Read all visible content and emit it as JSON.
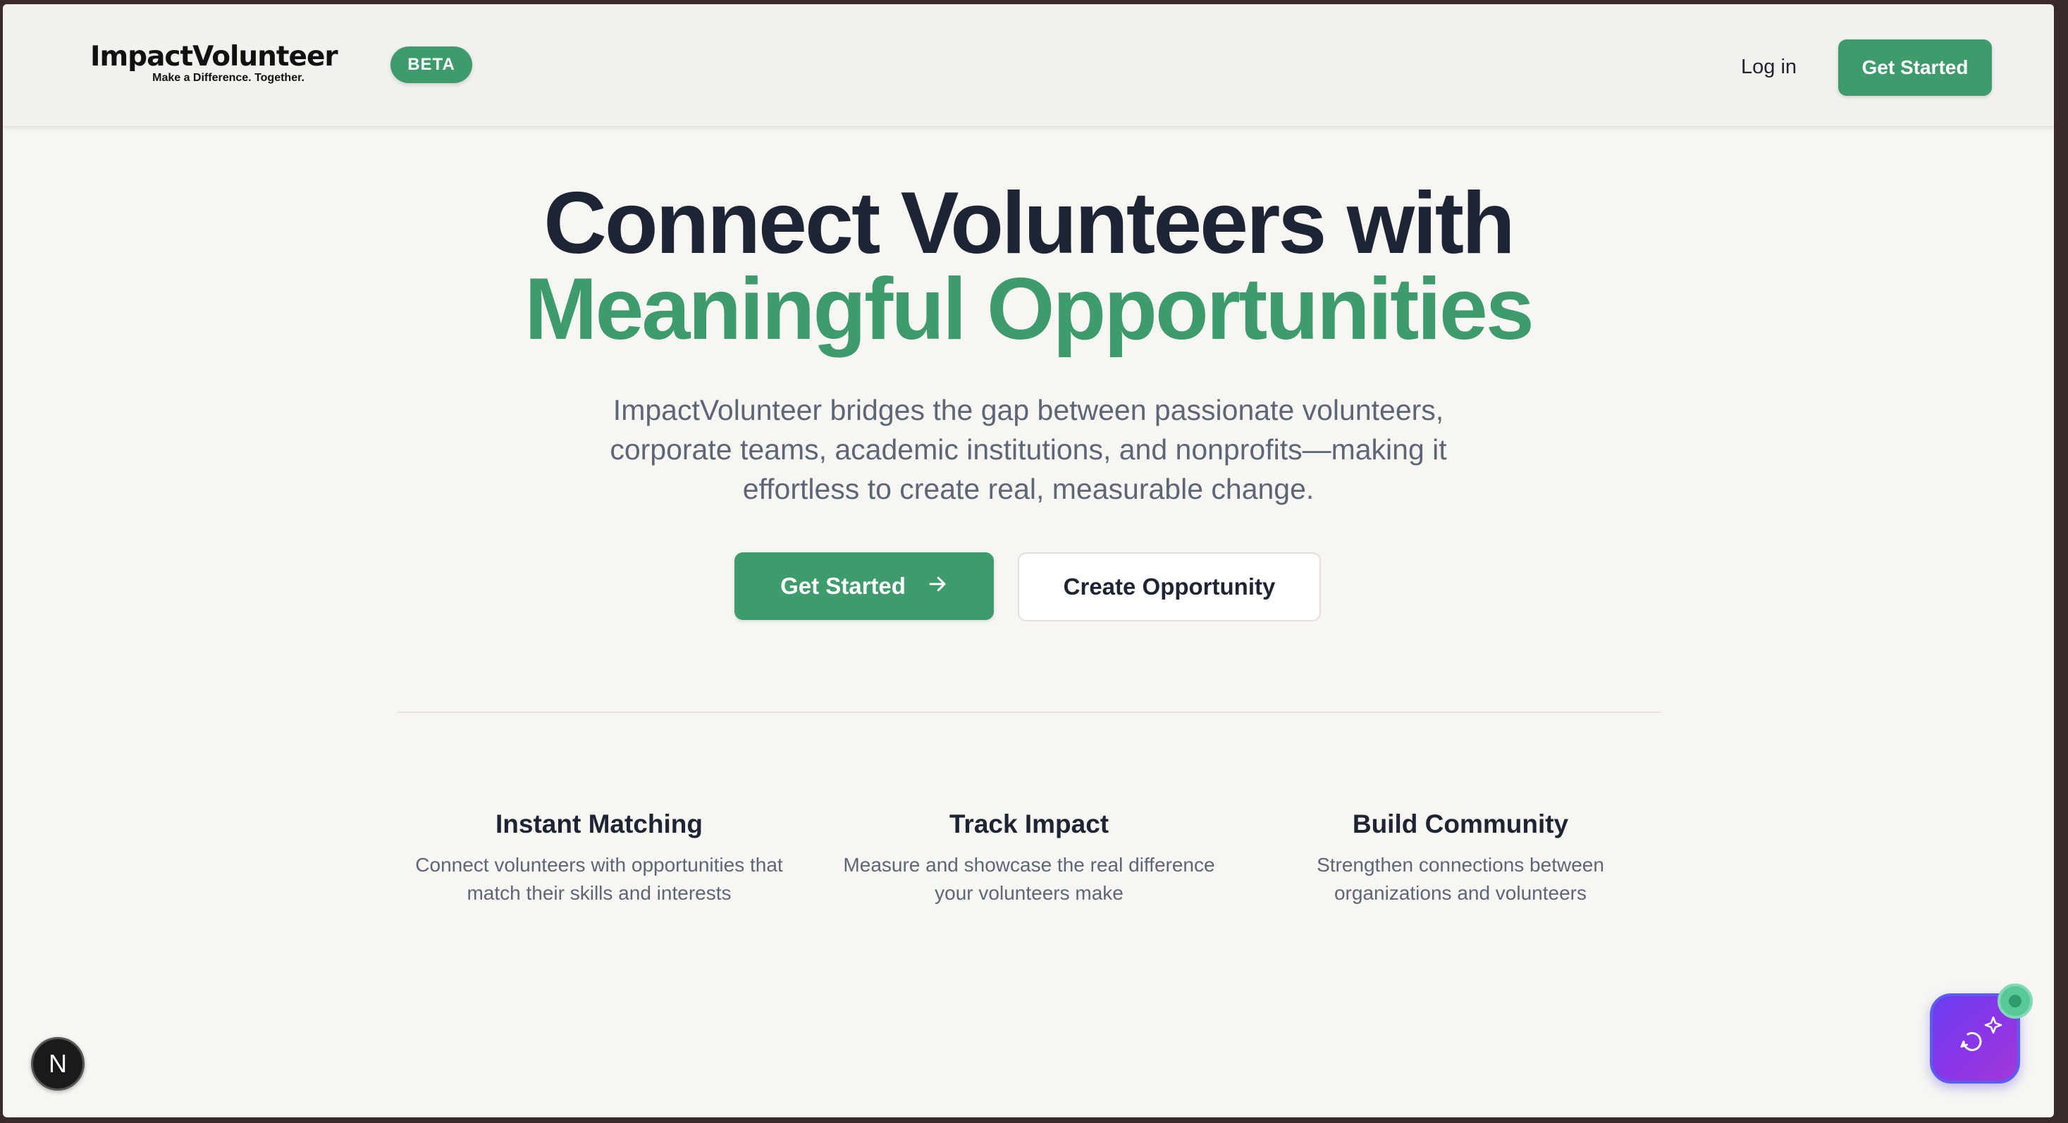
{
  "header": {
    "logo_name": "ImpactVolunteer",
    "logo_tagline": "Make a Difference. Together.",
    "beta_label": "BETA",
    "login_label": "Log in",
    "cta_label": "Get Started"
  },
  "hero": {
    "title_line1": "Connect Volunteers with",
    "title_line2": "Meaningful Opportunities",
    "subtitle": "ImpactVolunteer bridges the gap between passionate volunteers, corporate teams, academic institutions, and nonprofits—making it effortless to create real, measurable change.",
    "primary_button": "Get Started",
    "primary_button_icon": "arrow-right-icon",
    "secondary_button": "Create Opportunity"
  },
  "features": [
    {
      "title": "Instant Matching",
      "description": "Connect volunteers with opportunities that match their skills and interests"
    },
    {
      "title": "Track Impact",
      "description": "Measure and showcase the real difference your volunteers make"
    },
    {
      "title": "Build Community",
      "description": "Strengthen connections between organizations and volunteers"
    }
  ],
  "widgets": {
    "dev_badge_letter": "N",
    "chat_icon": "chat-sparkle-icon"
  },
  "colors": {
    "brand_green": "#3e9b6c",
    "heading_dark": "#1d2433",
    "body_gray": "#5d6677",
    "chat_purple": "#7a3aec"
  }
}
